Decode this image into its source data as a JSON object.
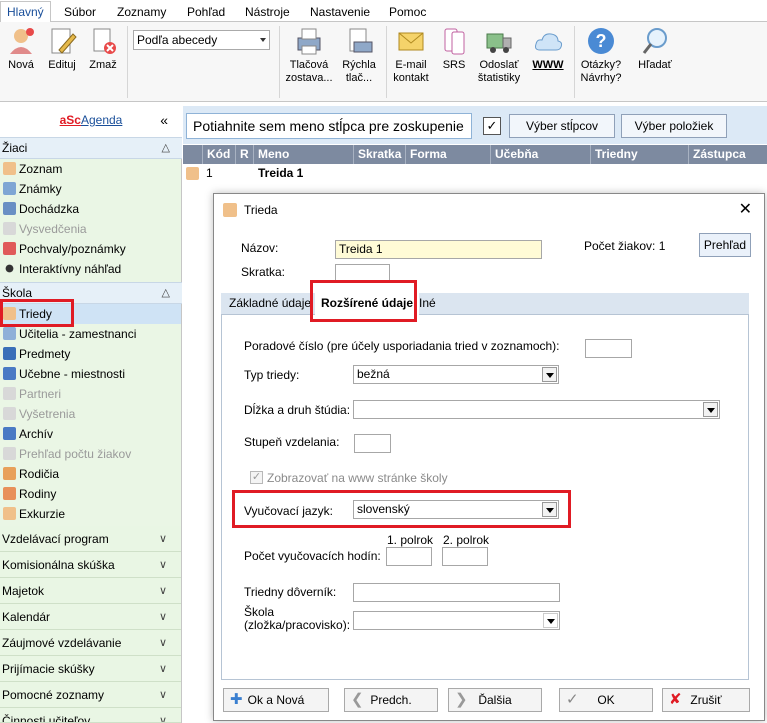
{
  "tabs": [
    "Hlavný",
    "Súbor",
    "Zoznamy",
    "Pohľad",
    "Nástroje",
    "Nastavenie",
    "Pomoc"
  ],
  "ribbon": {
    "nova": "Nová",
    "editovat": "Edituj",
    "zmazat": "Zmaž",
    "sort_value": "Podľa abecedy",
    "print_line1": "Tlačová",
    "print_line2": "zostava...",
    "quickprint_line1": "Rýchla",
    "quickprint_line2": "tlač...",
    "email_line1": "E-mail",
    "email_line2": "kontakt",
    "srs": "SRS",
    "send_line1": "Odoslať",
    "send_line2": "štatistiky",
    "www": "WWW",
    "help_line1": "Otázky?",
    "help_line2": "Návrhy?",
    "search": "Hľadať"
  },
  "sidebar": {
    "brand_asc": "aSc",
    "brand_agenda": "Agenda",
    "brand_collapse": "«",
    "section1": "Žiaci",
    "section1_items": [
      "Zoznam",
      "Známky",
      "Dochádzka",
      "Vysvedčenia",
      "Pochvaly/poznámky",
      "Interaktívny náhľad"
    ],
    "section2": "Škola",
    "section2_items": [
      "Triedy",
      "Učitelia - zamestnanci",
      "Predmety",
      "Učebne - miestnosti",
      "Partneri",
      "Vyšetrenia",
      "Archív",
      "Prehľad počtu žiakov",
      "Rodičia",
      "Rodiny",
      "Exkurzie"
    ],
    "collapsed": [
      "Vzdelávací program",
      "Komisionálna skúška",
      "Majetok",
      "Kalendár",
      "Záujmové vzdelávanie",
      "Prijímacie skúšky",
      "Pomocné zoznamy",
      "Činnosti učiteľov"
    ]
  },
  "grid": {
    "group_hint": "Potiahnite sem meno stĺpca pre zoskupenie",
    "columns_button": "Výber stĺpcov",
    "items_button": "Výber položiek",
    "headers": [
      "Kód",
      "R",
      "Meno",
      "Skratka",
      "Forma",
      "Učebňa",
      "Triedny",
      "Zástupca"
    ],
    "row": {
      "kod": "1",
      "meno": "Treida 1"
    }
  },
  "dialog": {
    "title": "Trieda",
    "nazov_label": "Názov:",
    "nazov_value": "Treida 1",
    "skratka_label": "Skratka:",
    "pocet_label": "Počet žiakov: 1",
    "prehlad_button": "Prehľad",
    "tabs": [
      "Základné údaje",
      "Rozšírené údaje",
      "Iné"
    ],
    "poradove_label": "Poradové číslo (pre účely usporiadania tried v zoznamoch):",
    "typ_label": "Typ triedy:",
    "typ_value": "bežná",
    "dlzka_label": "Dĺžka a druh štúdia:",
    "stupen_label": "Stupeň vzdelania:",
    "www_checkbox": "Zobrazovať na www stránke školy",
    "jazyk_label": "Vyučovací jazyk:",
    "jazyk_value": "slovenský",
    "polrok1": "1. polrok",
    "polrok2": "2. polrok",
    "hodiny_label": "Počet vyučovacích hodín:",
    "duvernik_label": "Triedny dôverník:",
    "skola_label1": "Škola",
    "skola_label2": "(zložka/pracovisko):",
    "buttons": {
      "ok_nova": "Ok a Nová",
      "predch": "Predch.",
      "dalsia": "Ďalšia",
      "ok": "OK",
      "zrusit": "Zrušiť"
    }
  }
}
